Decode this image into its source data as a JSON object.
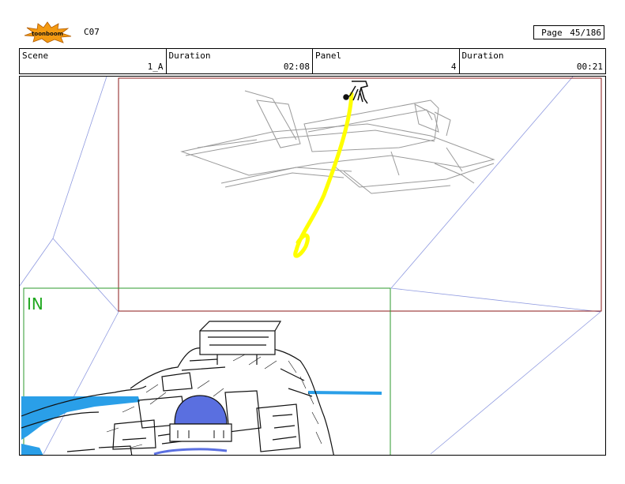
{
  "header": {
    "project": "C07",
    "page_label": "Page",
    "page_value": "45/186",
    "scene_label": "Scene",
    "scene_value": "1_A",
    "duration_label": "Duration",
    "duration_value": "02:08",
    "panel_label": "Panel",
    "panel_value": "4",
    "panel_duration_label": "Duration",
    "panel_duration_value": "00:21"
  },
  "panel": {
    "in_label": "IN"
  },
  "colors": {
    "camera_frame": "#8b1a1a",
    "in_frame": "#2e9a2e",
    "rope": "#ffff00",
    "water": "#2a9fe8",
    "dome": "#5a6fe0",
    "perspective_lines": "#8f9ae0"
  }
}
